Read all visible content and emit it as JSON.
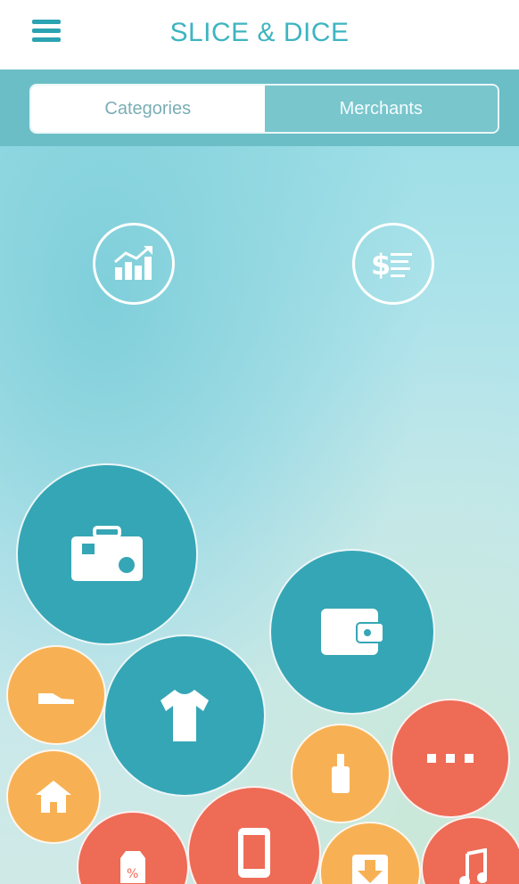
{
  "header": {
    "title": "SLICE & DICE",
    "menu_icon": "hamburger-menu-icon"
  },
  "segmented_control": {
    "categories_label": "Categories",
    "merchants_label": "Merchants",
    "selected": "Categories"
  },
  "top_actions": [
    {
      "icon": "growth-chart-icon"
    },
    {
      "icon": "dollar-list-icon"
    }
  ],
  "bubbles": [
    {
      "icon": "travel-suitcase-icon",
      "color": "#35a6b5"
    },
    {
      "icon": "wallet-icon",
      "color": "#35a6b5"
    },
    {
      "icon": "tshirt-icon",
      "color": "#35a6b5"
    },
    {
      "icon": "shoe-icon",
      "color": "#f7b154"
    },
    {
      "icon": "house-icon",
      "color": "#f7b154"
    },
    {
      "icon": "bottle-icon",
      "color": "#f7b154"
    },
    {
      "icon": "more-dots-icon",
      "color": "#ee6b56"
    },
    {
      "icon": "price-tag-icon",
      "color": "#ee6b56"
    },
    {
      "icon": "mobile-phone-icon",
      "color": "#ee6b56"
    },
    {
      "icon": "download-icon",
      "color": "#f7b154"
    },
    {
      "icon": "music-note-icon",
      "color": "#ee6b56"
    }
  ],
  "colors": {
    "accent": "#35a6b5",
    "orange": "#f7b154",
    "red": "#ee6b56",
    "segment_bar": "#6bbec6"
  }
}
